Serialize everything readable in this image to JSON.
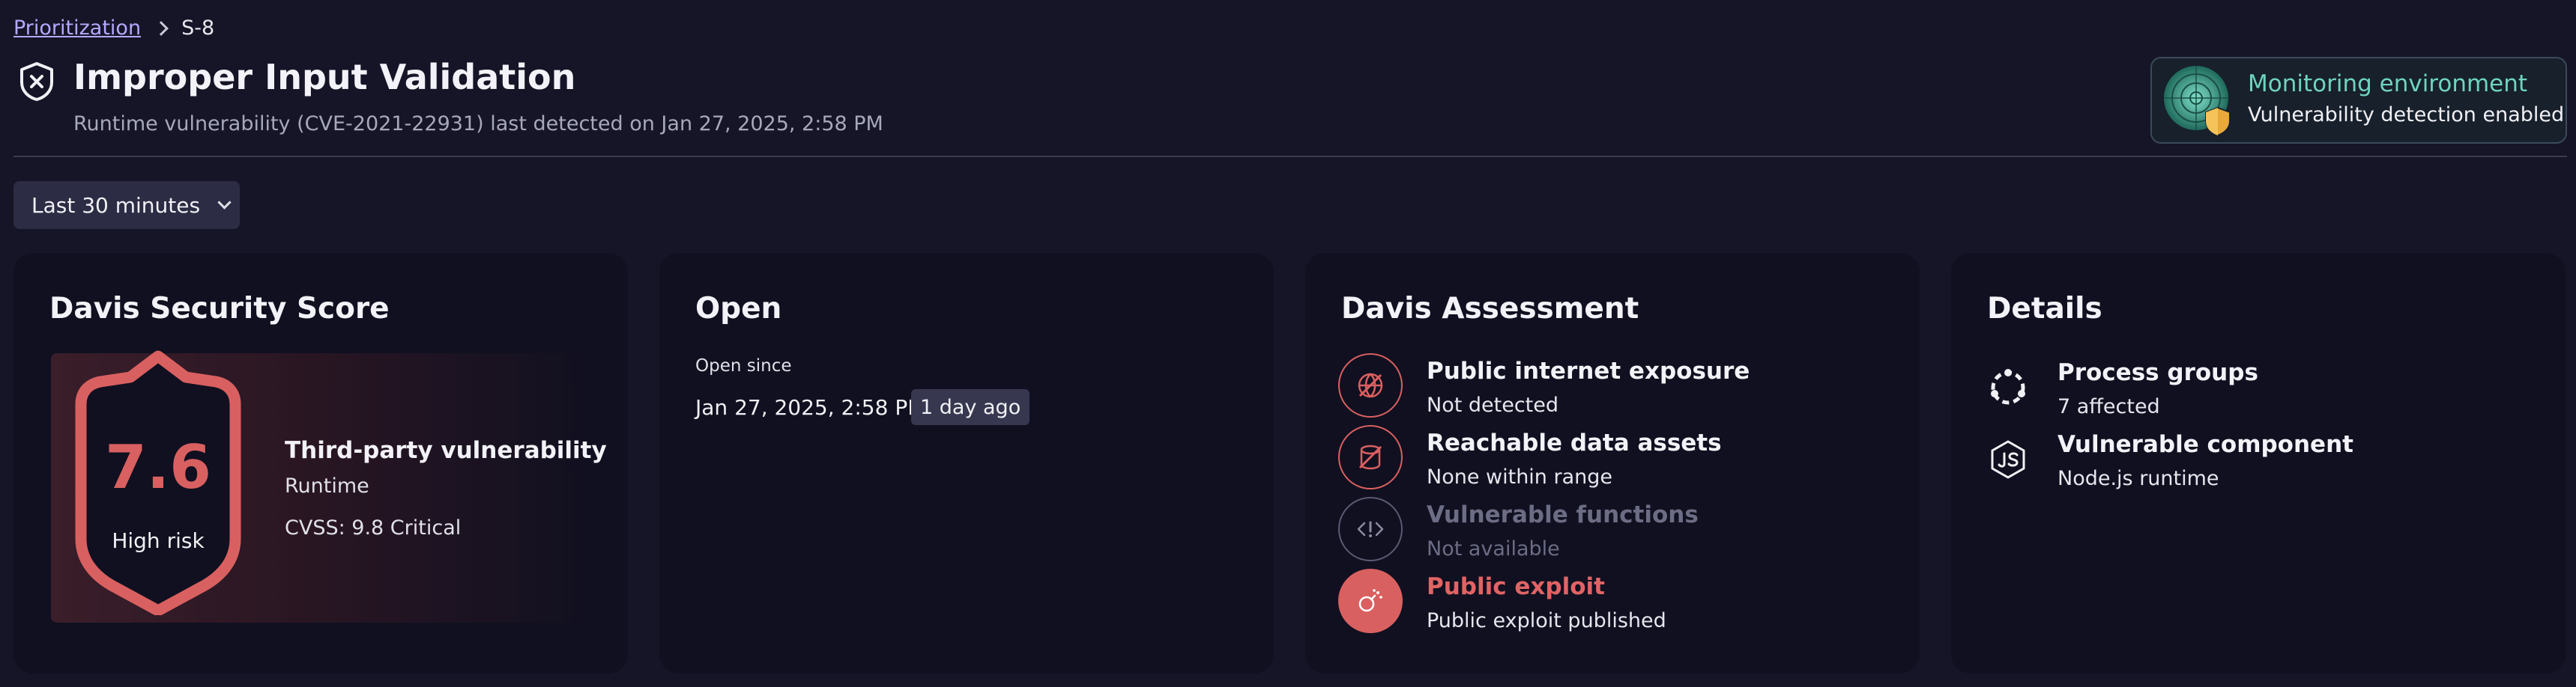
{
  "breadcrumb": {
    "parent": "Prioritization",
    "current": "S-8"
  },
  "header": {
    "title": "Improper Input Validation",
    "subtitle": "Runtime vulnerability (CVE-2021-22931) last detected on Jan 27, 2025, 2:58 PM",
    "icon": "shield-x-icon"
  },
  "monitoring": {
    "title": "Monitoring environment",
    "subtitle": "Vulnerability detection enabled",
    "icon": "radar-shield-icon"
  },
  "timeframe": {
    "label": "Last 30 minutes"
  },
  "score_card": {
    "title": "Davis Security Score",
    "score": "7.6",
    "risk": "High risk",
    "type": "Third-party vulnerability",
    "runtime": "Runtime",
    "cvss": "CVSS: 9.8 Critical"
  },
  "open_card": {
    "title": "Open",
    "since_label": "Open since",
    "since_date": "Jan 27, 2025, 2:58 PM",
    "badge": "1 day ago"
  },
  "assessment": {
    "title": "Davis Assessment",
    "items": [
      {
        "name": "Public internet exposure",
        "value": "Not detected",
        "icon": "globe-crossed-icon"
      },
      {
        "name": "Reachable data assets",
        "value": "None within range",
        "icon": "database-crossed-icon"
      },
      {
        "name": "Vulnerable functions",
        "value": "Not available",
        "icon": "code-alert-icon"
      },
      {
        "name": "Public exploit",
        "value": "Public exploit published",
        "icon": "bomb-icon"
      }
    ]
  },
  "details": {
    "title": "Details",
    "items": [
      {
        "name": "Process groups",
        "value": "7 affected",
        "icon": "process-group-icon"
      },
      {
        "name": "Vulnerable component",
        "value": "Node.js runtime",
        "icon": "nodejs-icon"
      }
    ]
  },
  "colors": {
    "background": "#151527",
    "card": "#101020",
    "danger": "#d96060",
    "accent_link": "#b5a8ff",
    "monitor_accent": "#6fd3c1"
  }
}
